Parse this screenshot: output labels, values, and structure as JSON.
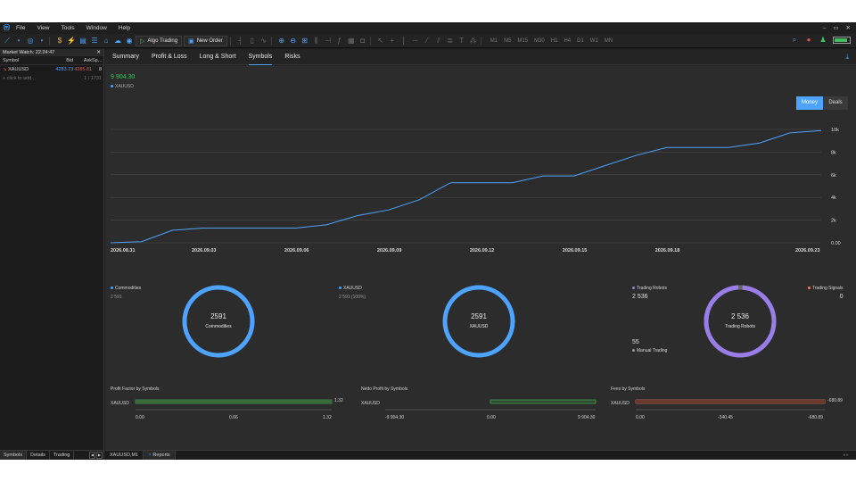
{
  "menu": [
    "File",
    "View",
    "Tools",
    "Window",
    "Help"
  ],
  "window_controls": [
    "–",
    "▭",
    "✕"
  ],
  "toolbar": {
    "algo_trading": "Algo Trading",
    "new_order": "New Order",
    "timeframes": [
      "M1",
      "M5",
      "M15",
      "M30",
      "H1",
      "H4",
      "D1",
      "W1",
      "MN"
    ]
  },
  "market_watch": {
    "title": "Market Watch: 22:24:47",
    "columns": [
      "Symbol",
      "Bid",
      "Ask",
      "Sp..."
    ],
    "rows": [
      {
        "symbol": "XAUUSD",
        "bid": "4283.73",
        "ask": "4285.81",
        "spread": "8"
      }
    ],
    "add_placeholder": "click to add...",
    "count": "1 / 1731",
    "tabs": [
      "Symbols",
      "Details",
      "Trading"
    ]
  },
  "report_tabs": [
    "Summary",
    "Profit & Loss",
    "Long & Short",
    "Symbols",
    "Risks"
  ],
  "active_report_tab": "Symbols",
  "balance": "9 904.30",
  "balance_symbol": "XAUUSD",
  "toggle": {
    "money": "Money",
    "deals": "Deals"
  },
  "colors": {
    "accent": "#4da3ff",
    "profit": "#3fbf5f",
    "fees": "#f08060",
    "robots": "#9b7dea"
  },
  "chart_data": {
    "type": "line",
    "series": [
      {
        "name": "XAUUSD",
        "x": [
          "2026.08.31",
          "2026.09.01",
          "2026.09.02",
          "2026.09.03",
          "2026.09.04",
          "2026.09.05",
          "2026.09.06",
          "2026.09.07",
          "2026.09.08",
          "2026.09.09",
          "2026.09.10",
          "2026.09.11",
          "2026.09.12",
          "2026.09.13",
          "2026.09.14",
          "2026.09.15",
          "2026.09.16",
          "2026.09.17",
          "2026.09.18",
          "2026.09.19",
          "2026.09.20",
          "2026.09.21",
          "2026.09.22",
          "2026.09.23"
        ],
        "values": [
          0,
          100,
          1100,
          1300,
          1300,
          1300,
          1300,
          1600,
          2400,
          2900,
          3800,
          5300,
          5300,
          5300,
          5900,
          5900,
          6800,
          7700,
          8400,
          8400,
          8400,
          8800,
          9700,
          9904.3
        ]
      }
    ],
    "x_tick_labels": [
      "2026.08.31",
      "2026.09.03",
      "2026.09.06",
      "2026.09.09",
      "2026.09.12",
      "2026.09.15",
      "2026.09.18",
      "2026.09.23"
    ],
    "y_tick_labels": [
      "10k",
      "8k",
      "6k",
      "4k",
      "2k",
      "0.00"
    ],
    "ylim": [
      0,
      10000
    ],
    "grid": true
  },
  "donuts": [
    {
      "legend": "Commodities",
      "legend_value": "2 591",
      "center_value": "2591",
      "center_label": "Commodities"
    },
    {
      "legend": "XAUUSD",
      "legend_value": "2 591 (100%)",
      "center_value": "2591",
      "center_label": "XAUUSD"
    },
    {
      "legend_robots": "Trading Robots",
      "robots_value": "2 536",
      "legend_signals": "Trading Signals",
      "signals_value": "0",
      "manual_value": "55",
      "manual_label": "Manual Trading",
      "center_value": "2 536",
      "center_label": "Trading Robots",
      "robots_fraction": 0.979
    }
  ],
  "mini_charts": [
    {
      "title": "Profit Factor by Symbols",
      "symbol": "XAUUSD",
      "value": "1.32",
      "ticks": [
        "0.00",
        "0.66",
        "1.32"
      ],
      "fraction": 1.0
    },
    {
      "title": "Netto Profit by Symbols",
      "symbol": "XAUUSD",
      "value": "",
      "ticks": [
        "-9 904.30",
        "0.00",
        "9 904.30"
      ],
      "fraction": 0.5
    },
    {
      "title": "Fees by Symbols",
      "symbol": "XAUUSD",
      "value": "-680.89",
      "ticks": [
        "0.00",
        "-340.45",
        "-680.89"
      ],
      "fraction": 1.0
    }
  ],
  "bottom_tabs": [
    "XAUUSD,M1",
    "Reports"
  ]
}
